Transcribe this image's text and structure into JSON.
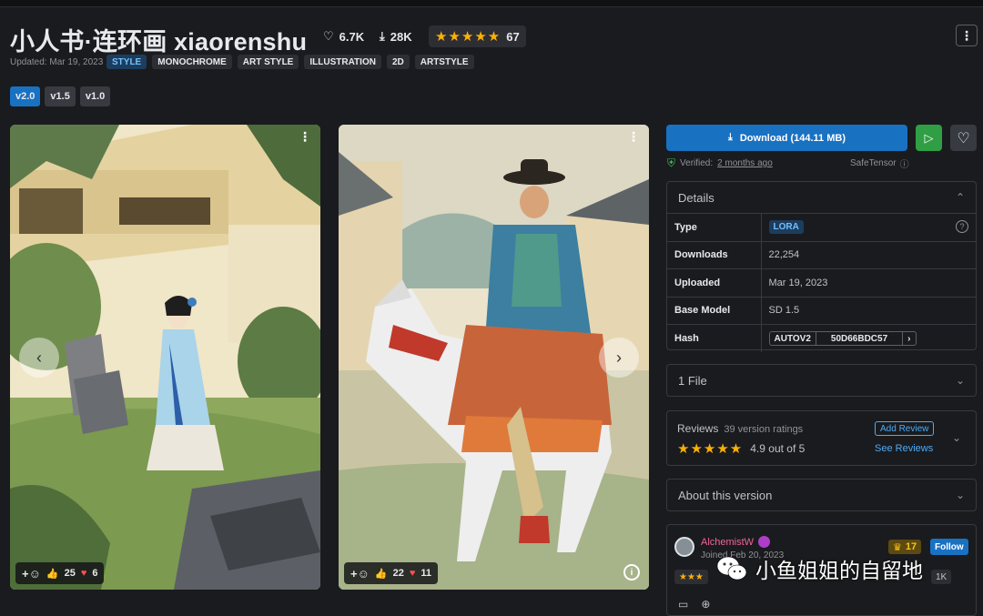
{
  "header": {
    "title": "小人书·连环画 xiaorenshu",
    "likes": "6.7K",
    "downloads": "28K",
    "rating_count": "67",
    "updated": "Updated: Mar 19, 2023",
    "tags": [
      "STYLE",
      "MONOCHROME",
      "ART STYLE",
      "ILLUSTRATION",
      "2D",
      "ARTSTYLE"
    ],
    "versions": [
      "v2.0",
      "v1.5",
      "v1.0"
    ]
  },
  "gallery": [
    {
      "thumbs": "25",
      "hearts": "6"
    },
    {
      "thumbs": "22",
      "hearts": "11"
    }
  ],
  "actions": {
    "download_label": "Download (144.11 MB)",
    "verified_label": "Verified:",
    "verified_time": "2 months ago",
    "safetensor": "SafeTensor"
  },
  "details": {
    "title": "Details",
    "rows": [
      {
        "key": "Type",
        "value": "LORA"
      },
      {
        "key": "Downloads",
        "value": "22,254"
      },
      {
        "key": "Uploaded",
        "value": "Mar 19, 2023"
      },
      {
        "key": "Base Model",
        "value": "SD 1.5"
      },
      {
        "key": "Hash",
        "value": "50D66BDC57",
        "hash_type": "AUTOV2"
      }
    ]
  },
  "files": {
    "title": "1 File"
  },
  "reviews": {
    "title": "Reviews",
    "count": "39 version ratings",
    "score": "4.9 out of 5",
    "add": "Add Review",
    "see": "See Reviews"
  },
  "about": {
    "title": "About this version"
  },
  "creator": {
    "name": "AlchemistW",
    "joined": "Joined Feb 20, 2023",
    "crown_count": "17",
    "follow": "Follow",
    "stat_right": "1K"
  },
  "watermark": "小鱼姐姐的自留地",
  "icons": {
    "like": "heart-icon",
    "download": "download-icon",
    "play": "play-icon"
  },
  "colors": {
    "accent": "#1971c2",
    "run": "#2f9e44",
    "star": "#fab005",
    "bg": "#1a1b1e"
  }
}
